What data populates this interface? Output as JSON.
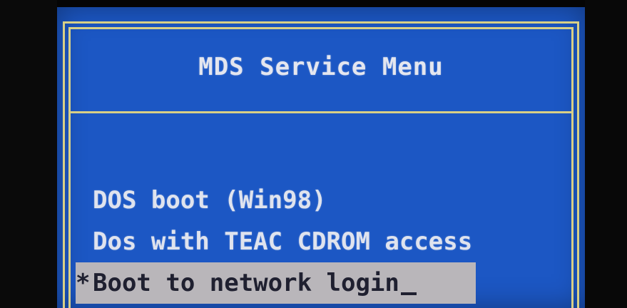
{
  "menu": {
    "title": "MDS Service Menu",
    "items": [
      {
        "marker": "",
        "label": "DOS boot (Win98)",
        "selected": false
      },
      {
        "marker": "",
        "label": "Dos with TEAC CDROM access",
        "selected": false
      },
      {
        "marker": "*",
        "label": "Boot to network login",
        "selected": true
      }
    ]
  },
  "colors": {
    "background": "#1c57c4",
    "frame": "#d8cf86",
    "text": "#e4e6ef",
    "highlight": "#b9b6ba",
    "highlight_text": "#1f2030"
  }
}
